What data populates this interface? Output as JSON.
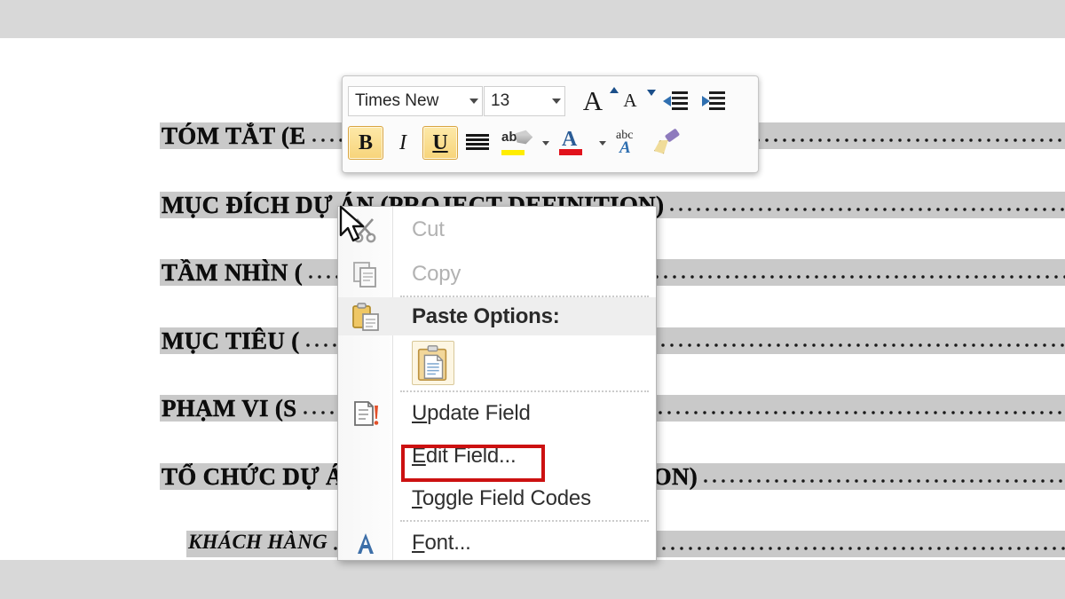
{
  "document": {
    "type": "word-table-of-contents",
    "rows": [
      {
        "title": "TÓM TẮT (E",
        "style": "heading",
        "leader": true
      },
      {
        "title": "MỤC ĐÍCH DỰ ÁN (PROJECT DEFINITION)",
        "style": "heading",
        "leader": true
      },
      {
        "title": "TẦM NHÌN (",
        "style": "heading",
        "leader": true
      },
      {
        "title": "MỤC TIÊU (",
        "style": "heading",
        "leader": true
      },
      {
        "title": "PHẠM VI (S",
        "style": "heading",
        "leader": true
      },
      {
        "title": "TỔ CHỨC DỰ ÁN (PROJECT ORGANIZATION)",
        "style": "heading",
        "leader": true
      },
      {
        "title": "KHÁCH HÀNG",
        "style": "subheading",
        "leader": false
      }
    ]
  },
  "minibar": {
    "font_name": "Times New",
    "font_size": "13",
    "grow_glyph": "A",
    "shrink_glyph": "A",
    "bold_glyph": "B",
    "italic_glyph": "I",
    "underline_glyph": "U",
    "highlight_glyph": "ab",
    "text_effects_top": "abc",
    "text_effects_bottom": "A",
    "font_color_glyph": "A",
    "font_color_hex": "#e1121c",
    "highlight_color_hex": "#ffed00",
    "active_buttons": [
      "bold",
      "underline"
    ]
  },
  "context_menu": {
    "items": [
      {
        "label": "Cut",
        "accel": "t",
        "icon": "scissors-icon",
        "state": "disabled",
        "type": "command"
      },
      {
        "label": "Copy",
        "accel": "C",
        "icon": "copy-icon",
        "state": "disabled",
        "type": "command"
      },
      {
        "label": "Paste Options:",
        "icon": "paste-icon",
        "state": "header",
        "type": "header"
      },
      {
        "label": "",
        "icon": "paste-keep-source-formatting-icon",
        "state": "normal",
        "type": "paste-gallery"
      },
      {
        "label": "Update Field",
        "accel": "U",
        "icon": "update-field-icon",
        "state": "normal",
        "type": "command"
      },
      {
        "label": "Edit Field...",
        "accel": "E",
        "icon": "",
        "state": "highlighted",
        "type": "command"
      },
      {
        "label": "Toggle Field Codes",
        "accel": "T",
        "icon": "",
        "state": "normal",
        "type": "command"
      },
      {
        "label": "Font...",
        "accel": "F",
        "icon": "font-icon",
        "state": "clipped",
        "type": "command"
      }
    ]
  },
  "annotation": {
    "highlight_target": "Edit Field...",
    "box_color": "#cc1111"
  },
  "letterbox": {
    "color": "#d8d8d8"
  }
}
